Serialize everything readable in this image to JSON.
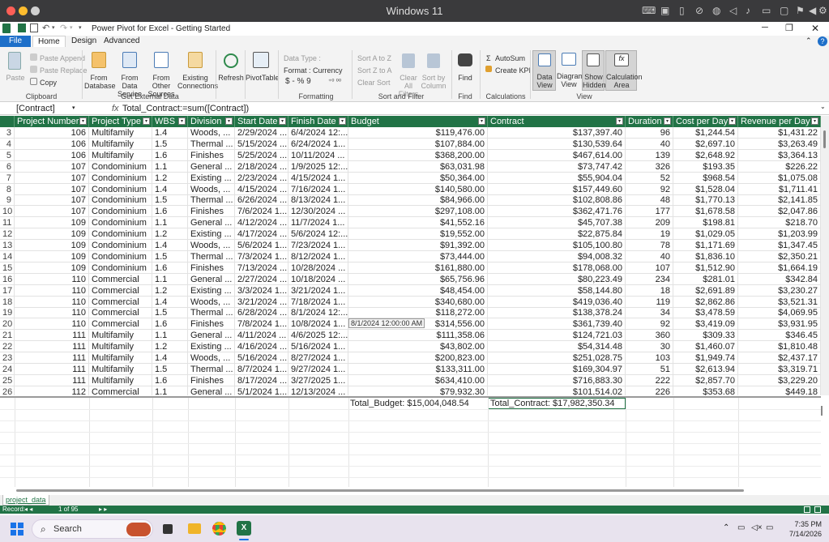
{
  "mac": {
    "title": "Windows 11"
  },
  "title": {
    "doc": "Power Pivot for Excel - Getting Started"
  },
  "tabs": [
    "File",
    "Home",
    "Design",
    "Advanced"
  ],
  "ribbon": {
    "paste": "Paste",
    "paste_append": "Paste Append",
    "paste_replace": "Paste Replace",
    "copy": "Copy",
    "from_db": "From",
    "from_db2": "Database",
    "from_ds": "From Data",
    "from_ds2": "Service",
    "from_other": "From Other",
    "from_other2": "Sources",
    "existing": "Existing",
    "existing2": "Connections",
    "refresh": "Refresh",
    "pivottable": "PivotTable",
    "data_type": "Data Type :",
    "format": "Format : Currency",
    "sym": "$ - % 9",
    "sort_az": "Sort A to Z",
    "sort_za": "Sort Z to A",
    "clear_sort": "Clear Sort",
    "clear_all": "Clear All",
    "filters": "Filters",
    "sort_by": "Sort by",
    "column": "Column",
    "find": "Find",
    "autosum": "AutoSum",
    "create_kpi": "Create KPI",
    "data_view": "Data",
    "data_view2": "View",
    "diagram": "Diagram",
    "diagram2": "View",
    "show_hidden": "Show",
    "show_hidden2": "Hidden",
    "calc_area": "Calculation",
    "calc_area2": "Area",
    "groups": [
      "Clipboard",
      "Get External Data",
      "Formatting",
      "Sort and Filter",
      "Find",
      "Calculations",
      "View"
    ]
  },
  "formula": {
    "name": "[Contract]",
    "fx": "fx",
    "text": "Total_Contract:=sum([Contract])"
  },
  "headers": [
    "Project Number",
    "Project Type",
    "WBS",
    "Division",
    "Start Date",
    "Finish Date",
    "Budget",
    "Contract",
    "Duration",
    "Cost per Day",
    "Revenue per Day"
  ],
  "rows": [
    [
      "3",
      "106",
      "Multifamily",
      "1.4",
      "Woods, ...",
      "2/29/2024 ...",
      "6/4/2024 12:...",
      "$119,476.00",
      "$137,397.40",
      "96",
      "$1,244.54",
      "$1,431.22"
    ],
    [
      "4",
      "106",
      "Multifamily",
      "1.5",
      "Thermal ...",
      "5/15/2024 ...",
      "6/24/2024 1...",
      "$107,884.00",
      "$130,539.64",
      "40",
      "$2,697.10",
      "$3,263.49"
    ],
    [
      "5",
      "106",
      "Multifamily",
      "1.6",
      "Finishes",
      "5/25/2024 ...",
      "10/11/2024 ...",
      "$368,200.00",
      "$467,614.00",
      "139",
      "$2,648.92",
      "$3,364.13"
    ],
    [
      "6",
      "107",
      "Condominium",
      "1.1",
      "General ...",
      "2/18/2024 ...",
      "1/9/2025 12:...",
      "$63,031.98",
      "$73,747.42",
      "326",
      "$193.35",
      "$226.22"
    ],
    [
      "7",
      "107",
      "Condominium",
      "1.2",
      "Existing ...",
      "2/23/2024 ...",
      "4/15/2024 1...",
      "$50,364.00",
      "$55,904.04",
      "52",
      "$968.54",
      "$1,075.08"
    ],
    [
      "8",
      "107",
      "Condominium",
      "1.4",
      "Woods, ...",
      "4/15/2024 ...",
      "7/16/2024 1...",
      "$140,580.00",
      "$157,449.60",
      "92",
      "$1,528.04",
      "$1,711.41"
    ],
    [
      "9",
      "107",
      "Condominium",
      "1.5",
      "Thermal ...",
      "6/26/2024 ...",
      "8/13/2024 1...",
      "$84,966.00",
      "$102,808.86",
      "48",
      "$1,770.13",
      "$2,141.85"
    ],
    [
      "10",
      "107",
      "Condominium",
      "1.6",
      "Finishes",
      "7/6/2024 1...",
      "12/30/2024 ...",
      "$297,108.00",
      "$362,471.76",
      "177",
      "$1,678.58",
      "$2,047.86"
    ],
    [
      "11",
      "109",
      "Condominium",
      "1.1",
      "General ...",
      "4/12/2024 ...",
      "11/7/2024 1...",
      "$41,552.16",
      "$45,707.38",
      "209",
      "$198.81",
      "$218.70"
    ],
    [
      "12",
      "109",
      "Condominium",
      "1.2",
      "Existing ...",
      "4/17/2024 ...",
      "5/6/2024 12:...",
      "$19,552.00",
      "$22,875.84",
      "19",
      "$1,029.05",
      "$1,203.99"
    ],
    [
      "13",
      "109",
      "Condominium",
      "1.4",
      "Woods, ...",
      "5/6/2024 1...",
      "7/23/2024 1...",
      "$91,392.00",
      "$105,100.80",
      "78",
      "$1,171.69",
      "$1,347.45"
    ],
    [
      "14",
      "109",
      "Condominium",
      "1.5",
      "Thermal ...",
      "7/3/2024 1...",
      "8/12/2024 1...",
      "$73,444.00",
      "$94,008.32",
      "40",
      "$1,836.10",
      "$2,350.21"
    ],
    [
      "15",
      "109",
      "Condominium",
      "1.6",
      "Finishes",
      "7/13/2024 ...",
      "10/28/2024 ...",
      "$161,880.00",
      "$178,068.00",
      "107",
      "$1,512.90",
      "$1,664.19"
    ],
    [
      "16",
      "110",
      "Commercial",
      "1.1",
      "General ...",
      "2/27/2024 ...",
      "10/18/2024 ...",
      "$65,756.96",
      "$80,223.49",
      "234",
      "$281.01",
      "$342.84"
    ],
    [
      "17",
      "110",
      "Commercial",
      "1.2",
      "Existing ...",
      "3/3/2024 1...",
      "3/21/2024 1...",
      "$48,454.00",
      "$58,144.80",
      "18",
      "$2,691.89",
      "$3,230.27"
    ],
    [
      "18",
      "110",
      "Commercial",
      "1.4",
      "Woods, ...",
      "3/21/2024 ...",
      "7/18/2024 1...",
      "$340,680.00",
      "$419,036.40",
      "119",
      "$2,862.86",
      "$3,521.31"
    ],
    [
      "19",
      "110",
      "Commercial",
      "1.5",
      "Thermal ...",
      "6/28/2024 ...",
      "8/1/2024 12:...",
      "$118,272.00",
      "$138,378.24",
      "34",
      "$3,478.59",
      "$4,069.95"
    ],
    [
      "20",
      "110",
      "Commercial",
      "1.6",
      "Finishes",
      "7/8/2024 1...",
      "10/8/2024 1...",
      "$314,556.00",
      "$361,739.40",
      "92",
      "$3,419.09",
      "$3,931.95"
    ],
    [
      "21",
      "111",
      "Multifamily",
      "1.1",
      "General ...",
      "4/11/2024 ...",
      "4/6/2025 12:...",
      "$111,358.06",
      "$124,721.03",
      "360",
      "$309.33",
      "$346.45"
    ],
    [
      "22",
      "111",
      "Multifamily",
      "1.2",
      "Existing ...",
      "4/16/2024 ...",
      "5/16/2024 1...",
      "$43,802.00",
      "$54,314.48",
      "30",
      "$1,460.07",
      "$1,810.48"
    ],
    [
      "23",
      "111",
      "Multifamily",
      "1.4",
      "Woods, ...",
      "5/16/2024 ...",
      "8/27/2024 1...",
      "$200,823.00",
      "$251,028.75",
      "103",
      "$1,949.74",
      "$2,437.17"
    ],
    [
      "24",
      "111",
      "Multifamily",
      "1.5",
      "Thermal ...",
      "8/7/2024 1...",
      "9/27/2024 1...",
      "$133,311.00",
      "$169,304.97",
      "51",
      "$2,613.94",
      "$3,319.71"
    ],
    [
      "25",
      "111",
      "Multifamily",
      "1.6",
      "Finishes",
      "8/17/2024 ...",
      "3/27/2025 1...",
      "$634,410.00",
      "$716,883.30",
      "222",
      "$2,857.70",
      "$3,229.20"
    ],
    [
      "26",
      "112",
      "Commercial",
      "1.1",
      "General ...",
      "5/1/2024 1...",
      "12/13/2024 ...",
      "$79,932.30",
      "$101,514.02",
      "226",
      "$353.68",
      "$449.18"
    ]
  ],
  "tooltip": "8/1/2024 12:00:00 AM",
  "measures": {
    "budget": "Total_Budget: $15,004,048.54",
    "contract": "Total_Contract: $17,982,350.34"
  },
  "sheet": {
    "tab": "project_data"
  },
  "status": {
    "record": "Record:",
    "count": "1 of 95"
  },
  "taskbar": {
    "search": "Search",
    "time": "7:35 PM",
    "date": "7/14/2026"
  }
}
